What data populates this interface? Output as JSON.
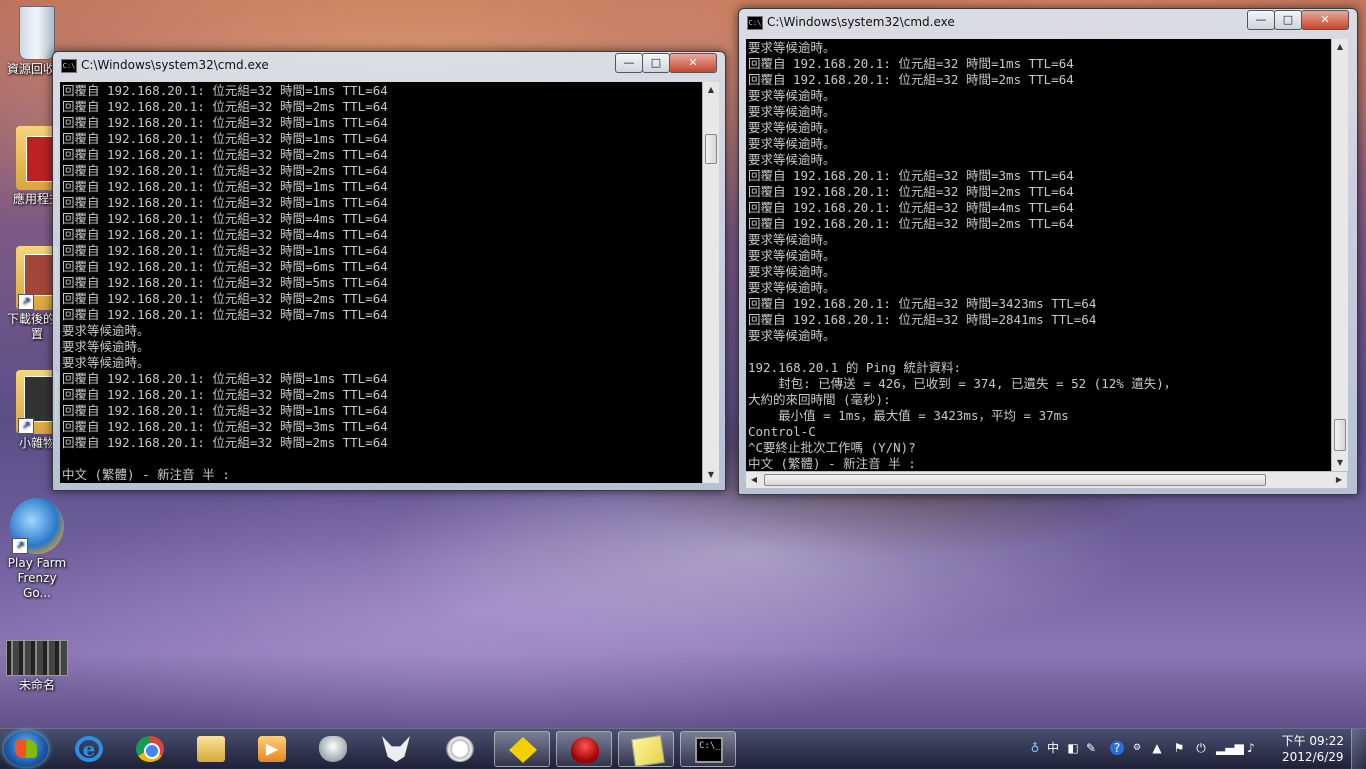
{
  "desktop": {
    "icons": [
      {
        "label": "資源回收筒",
        "icon": "recycle-bin-icon"
      },
      {
        "label": "應用程式",
        "icon": "folder-icon"
      },
      {
        "label": "下載後的位置",
        "icon": "folder-shortcut-icon"
      },
      {
        "label": "小雜物",
        "icon": "folder-shortcut-icon"
      },
      {
        "label": "Play Farm Frenzy Go...",
        "icon": "game-shortcut-icon"
      },
      {
        "label": "未命名",
        "icon": "file-icon"
      }
    ]
  },
  "windows": {
    "left": {
      "title": "C:\\Windows\\system32\\cmd.exe",
      "lines": [
        "回覆自 192.168.20.1: 位元組=32 時間=1ms TTL=64",
        "回覆自 192.168.20.1: 位元組=32 時間=2ms TTL=64",
        "回覆自 192.168.20.1: 位元組=32 時間=1ms TTL=64",
        "回覆自 192.168.20.1: 位元組=32 時間=1ms TTL=64",
        "回覆自 192.168.20.1: 位元組=32 時間=2ms TTL=64",
        "回覆自 192.168.20.1: 位元組=32 時間=2ms TTL=64",
        "回覆自 192.168.20.1: 位元組=32 時間=1ms TTL=64",
        "回覆自 192.168.20.1: 位元組=32 時間=1ms TTL=64",
        "回覆自 192.168.20.1: 位元組=32 時間=4ms TTL=64",
        "回覆自 192.168.20.1: 位元組=32 時間=4ms TTL=64",
        "回覆自 192.168.20.1: 位元組=32 時間=1ms TTL=64",
        "回覆自 192.168.20.1: 位元組=32 時間=6ms TTL=64",
        "回覆自 192.168.20.1: 位元組=32 時間=5ms TTL=64",
        "回覆自 192.168.20.1: 位元組=32 時間=2ms TTL=64",
        "回覆自 192.168.20.1: 位元組=32 時間=7ms TTL=64",
        "要求等候逾時。",
        "要求等候逾時。",
        "要求等候逾時。",
        "回覆自 192.168.20.1: 位元組=32 時間=1ms TTL=64",
        "回覆自 192.168.20.1: 位元組=32 時間=2ms TTL=64",
        "回覆自 192.168.20.1: 位元組=32 時間=1ms TTL=64",
        "回覆自 192.168.20.1: 位元組=32 時間=3ms TTL=64",
        "回覆自 192.168.20.1: 位元組=32 時間=2ms TTL=64",
        "",
        "中文 (繁體) - 新注音 半 :"
      ]
    },
    "right": {
      "title": "C:\\Windows\\system32\\cmd.exe",
      "lines": [
        "要求等候逾時。",
        "回覆自 192.168.20.1: 位元組=32 時間=1ms TTL=64",
        "回覆自 192.168.20.1: 位元組=32 時間=2ms TTL=64",
        "要求等候逾時。",
        "要求等候逾時。",
        "要求等候逾時。",
        "要求等候逾時。",
        "要求等候逾時。",
        "回覆自 192.168.20.1: 位元組=32 時間=3ms TTL=64",
        "回覆自 192.168.20.1: 位元組=32 時間=2ms TTL=64",
        "回覆自 192.168.20.1: 位元組=32 時間=4ms TTL=64",
        "回覆自 192.168.20.1: 位元組=32 時間=2ms TTL=64",
        "要求等候逾時。",
        "要求等候逾時。",
        "要求等候逾時。",
        "要求等候逾時。",
        "回覆自 192.168.20.1: 位元組=32 時間=3423ms TTL=64",
        "回覆自 192.168.20.1: 位元組=32 時間=2841ms TTL=64",
        "要求等候逾時。",
        "",
        "192.168.20.1 的 Ping 統計資料:",
        "    封包: 已傳送 = 426，已收到 = 374, 已遺失 = 52 (12% 遺失)，",
        "大約的來回時間 (毫秒):",
        "    最小值 = 1ms，最大值 = 3423ms，平均 = 37ms",
        "Control-C",
        "^C要終止批次工作嗎 (Y/N)?",
        "中文 (繁體) - 新注音 半 :"
      ]
    }
  },
  "window_controls": {
    "minimize": "—",
    "maximize": "□",
    "close": "✕"
  },
  "taskbar": {
    "apps": [
      {
        "name": "internet-explorer-icon",
        "active": false
      },
      {
        "name": "chrome-icon",
        "active": false
      },
      {
        "name": "explorer-icon",
        "active": false
      },
      {
        "name": "media-player-icon",
        "active": false
      },
      {
        "name": "game-controller-icon",
        "active": false
      },
      {
        "name": "fox-icon",
        "active": false
      },
      {
        "name": "speed-gauge-icon",
        "active": false
      },
      {
        "name": "yellow-app-icon",
        "active": true
      },
      {
        "name": "red-app-icon",
        "active": true
      },
      {
        "name": "sticky-notes-icon",
        "active": true
      },
      {
        "name": "cmd-icon",
        "active": true
      }
    ],
    "tray": {
      "ime_lang": "中",
      "clock_time": "下午 09:22",
      "clock_date": "2012/6/29"
    }
  },
  "colors": {
    "console_bg": "#000000",
    "console_text": "#c8c8c8",
    "title_text": "#111111"
  }
}
